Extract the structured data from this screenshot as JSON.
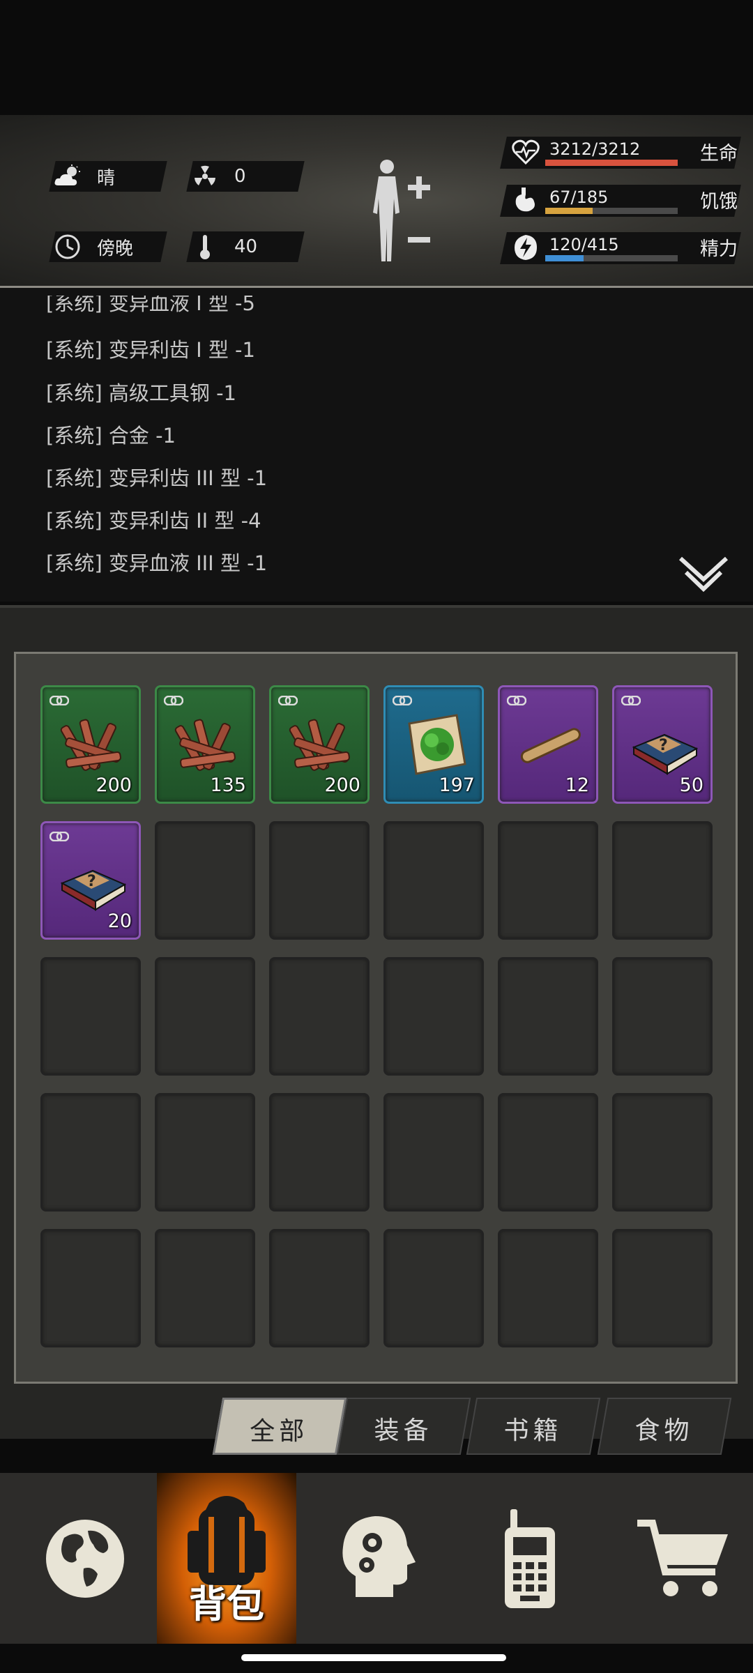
{
  "status": {
    "weather": "晴",
    "radiation": "0",
    "time_of_day": "傍晚",
    "temperature": "40"
  },
  "stats": [
    {
      "name": "生命",
      "value": "3212/3212",
      "fraction": 1.0,
      "color": "#d9533e",
      "icon": "heart-icon"
    },
    {
      "name": "饥饿",
      "value": "67/185",
      "fraction": 0.36,
      "color": "#d7a33f",
      "icon": "stomach-icon"
    },
    {
      "name": "精力",
      "value": "120/415",
      "fraction": 0.29,
      "color": "#3f8fd6",
      "icon": "energy-icon"
    }
  ],
  "log": [
    "[系统] 变异血液 I 型 -5",
    "[系统] 变异利齿 I 型 -1",
    "[系统] 高级工具钢 -1",
    "[系统] 合金 -1",
    "[系统] 变异利齿 III 型 -1",
    "[系统] 变异利齿 II 型 -4",
    "[系统] 变异血液 III 型 -1"
  ],
  "inventory": [
    {
      "rarity": "green",
      "icon": "wood-sticks-icon",
      "qty": "200"
    },
    {
      "rarity": "green",
      "icon": "wood-sticks-icon",
      "qty": "135"
    },
    {
      "rarity": "green",
      "icon": "wood-sticks-icon",
      "qty": "200"
    },
    {
      "rarity": "blue",
      "icon": "herb-cloth-icon",
      "qty": "197"
    },
    {
      "rarity": "purple",
      "icon": "wooden-club-icon",
      "qty": "12"
    },
    {
      "rarity": "purple",
      "icon": "mystery-book-icon",
      "qty": "50"
    },
    {
      "rarity": "purple",
      "icon": "mystery-book-icon",
      "qty": "20"
    }
  ],
  "tabs": [
    "全部",
    "装备",
    "书籍",
    "食物"
  ],
  "active_tab": 0,
  "nav": {
    "items": [
      "globe-icon",
      "backpack-icon",
      "head-gears-icon",
      "radio-icon",
      "cart-icon"
    ],
    "active_label": "背包"
  }
}
